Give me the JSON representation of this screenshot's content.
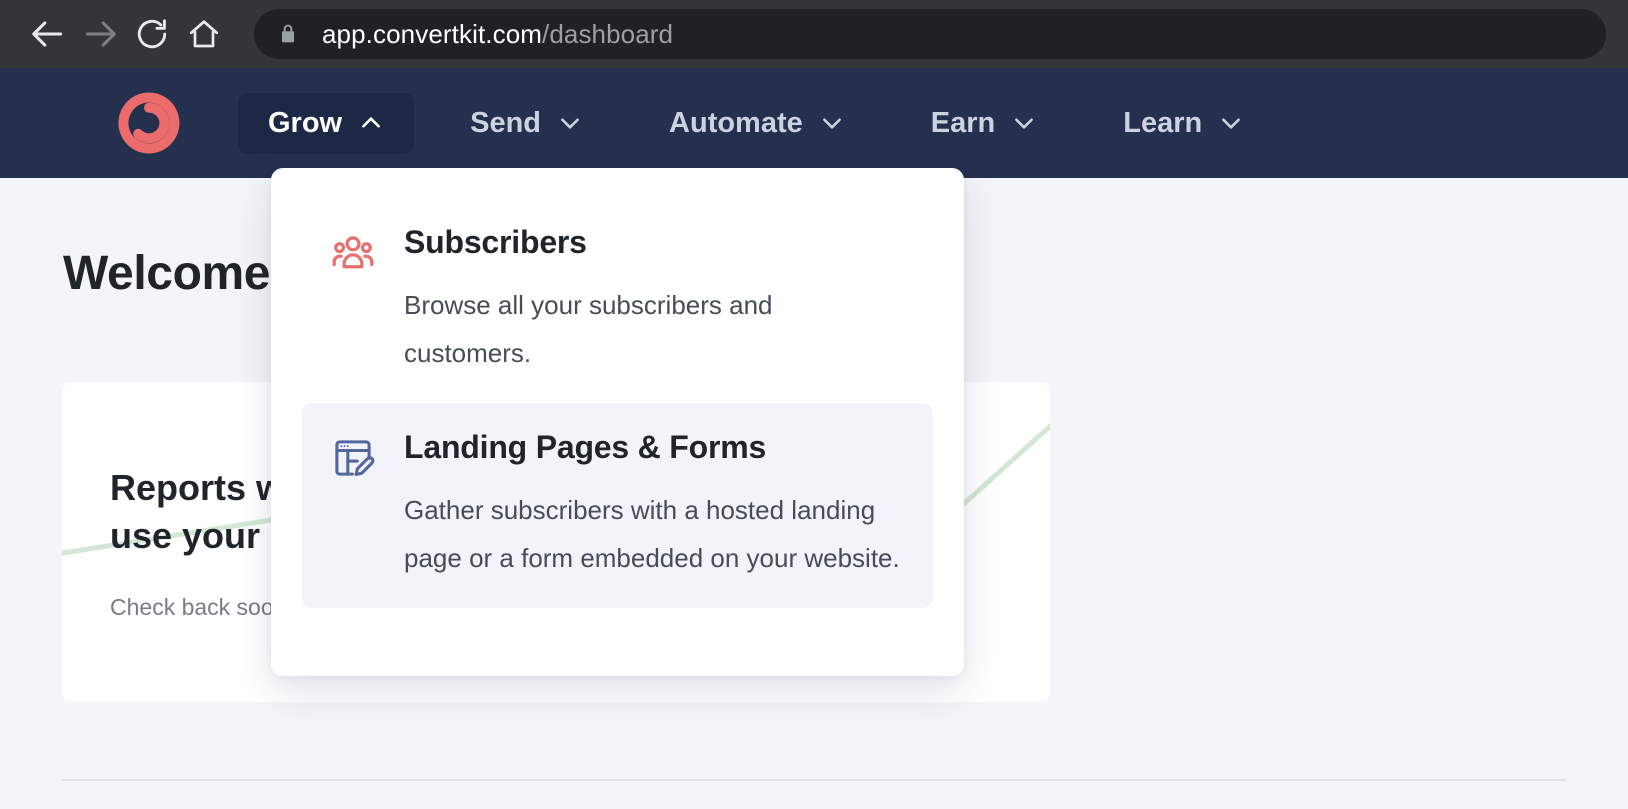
{
  "browser": {
    "back_icon": "arrow-left-icon",
    "forward_icon": "arrow-right-icon",
    "reload_icon": "reload-icon",
    "home_icon": "home-icon",
    "lock_icon": "lock-icon",
    "url_domain": "app.convertkit.com",
    "url_path": "/dashboard",
    "toolbar_bg": "#323639",
    "omnibox_bg": "#202124"
  },
  "app_nav": {
    "logo_name": "convertkit-logo",
    "logo_color": "#ec6b6b",
    "background": "#25304f",
    "items": [
      {
        "label": "Grow",
        "chevron": "chevron-up-icon",
        "active": true
      },
      {
        "label": "Send",
        "chevron": "chevron-down-icon",
        "active": false
      },
      {
        "label": "Automate",
        "chevron": "chevron-down-icon",
        "active": false
      },
      {
        "label": "Earn",
        "chevron": "chevron-down-icon",
        "active": false
      },
      {
        "label": "Learn",
        "chevron": "chevron-down-icon",
        "active": false
      }
    ]
  },
  "page": {
    "welcome_title": "Welcome",
    "card": {
      "heading": "Reports will show when you\nuse your account",
      "subtext": "Check back soon",
      "accent_color": "#d3e7d4"
    }
  },
  "dropdown": {
    "open_for": "Grow",
    "items": [
      {
        "icon": "users-group-icon",
        "icon_color": "#e8716f",
        "title": "Subscribers",
        "description": "Browse all your subscribers and customers.",
        "highlighted": false
      },
      {
        "icon": "landing-page-edit-icon",
        "icon_color": "#54669e",
        "title": "Landing Pages & Forms",
        "description": "Gather subscribers with a hosted landing page or a form embedded on your website.",
        "highlighted": true
      }
    ]
  }
}
